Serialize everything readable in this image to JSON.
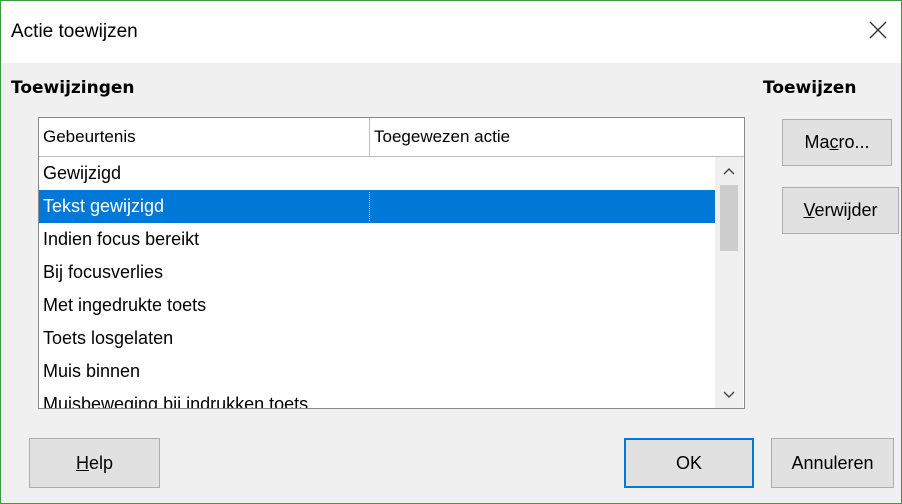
{
  "window": {
    "title": "Actie toewijzen"
  },
  "assignments": {
    "label": "Toewijzingen",
    "columns": [
      "Gebeurtenis",
      "Toegewezen actie"
    ],
    "rows": [
      {
        "event": "Gewijzigd",
        "action": ""
      },
      {
        "event": "Tekst gewijzigd",
        "action": "",
        "selected": true
      },
      {
        "event": "Indien focus bereikt",
        "action": ""
      },
      {
        "event": "Bij focusverlies",
        "action": ""
      },
      {
        "event": "Met ingedrukte toets",
        "action": ""
      },
      {
        "event": "Toets losgelaten",
        "action": ""
      },
      {
        "event": "Muis binnen",
        "action": ""
      },
      {
        "event": "Muisbeweging bij indrukken toets",
        "action": ""
      }
    ]
  },
  "assign": {
    "label": "Toewijzen",
    "macro": {
      "pre": "Ma",
      "key": "c",
      "post": "ro..."
    },
    "remove": {
      "key": "V",
      "post": "erwijder"
    }
  },
  "buttons": {
    "help": {
      "key": "H",
      "post": "elp"
    },
    "ok": "OK",
    "cancel": "Annuleren"
  },
  "icons": {
    "close": "close-icon",
    "scroll_up": "chevron-up-icon",
    "scroll_down": "chevron-down-icon"
  },
  "colors": {
    "selection": "#0078d7",
    "window_border": "#3c9a3c"
  }
}
